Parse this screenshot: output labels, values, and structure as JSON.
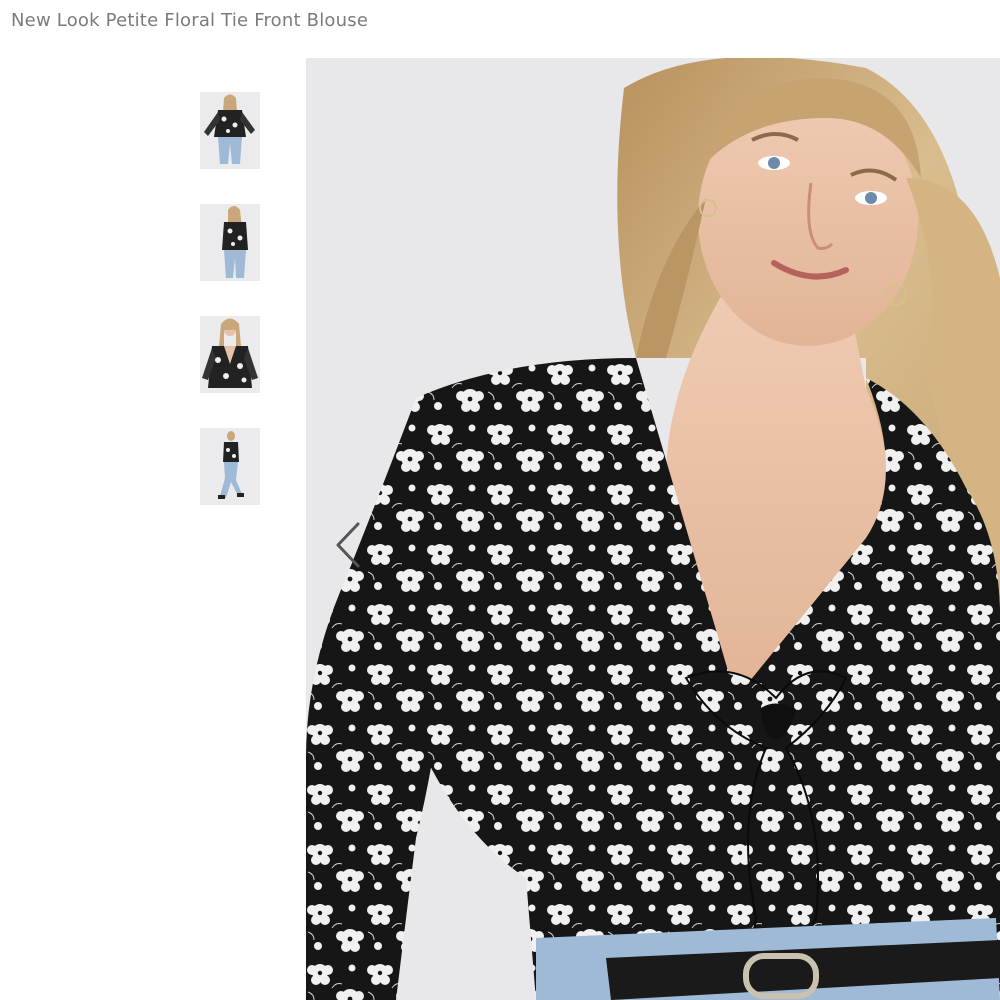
{
  "product": {
    "title": "New Look Petite Floral Tie Front Blouse"
  },
  "gallery": {
    "thumbnails": [
      {
        "label": "thumbnail-1"
      },
      {
        "label": "thumbnail-2"
      },
      {
        "label": "thumbnail-3"
      },
      {
        "label": "thumbnail-4"
      }
    ],
    "prev_icon": "chevron-left-icon"
  },
  "colors": {
    "title_text": "#7b7b7b",
    "background": "#e8e8ea",
    "blouse_dark": "#1a1a1a",
    "blouse_flower": "#f2f2f2",
    "skin": "#e9c1a6",
    "hair": "#c9a77a",
    "denim": "#9fbad6"
  }
}
